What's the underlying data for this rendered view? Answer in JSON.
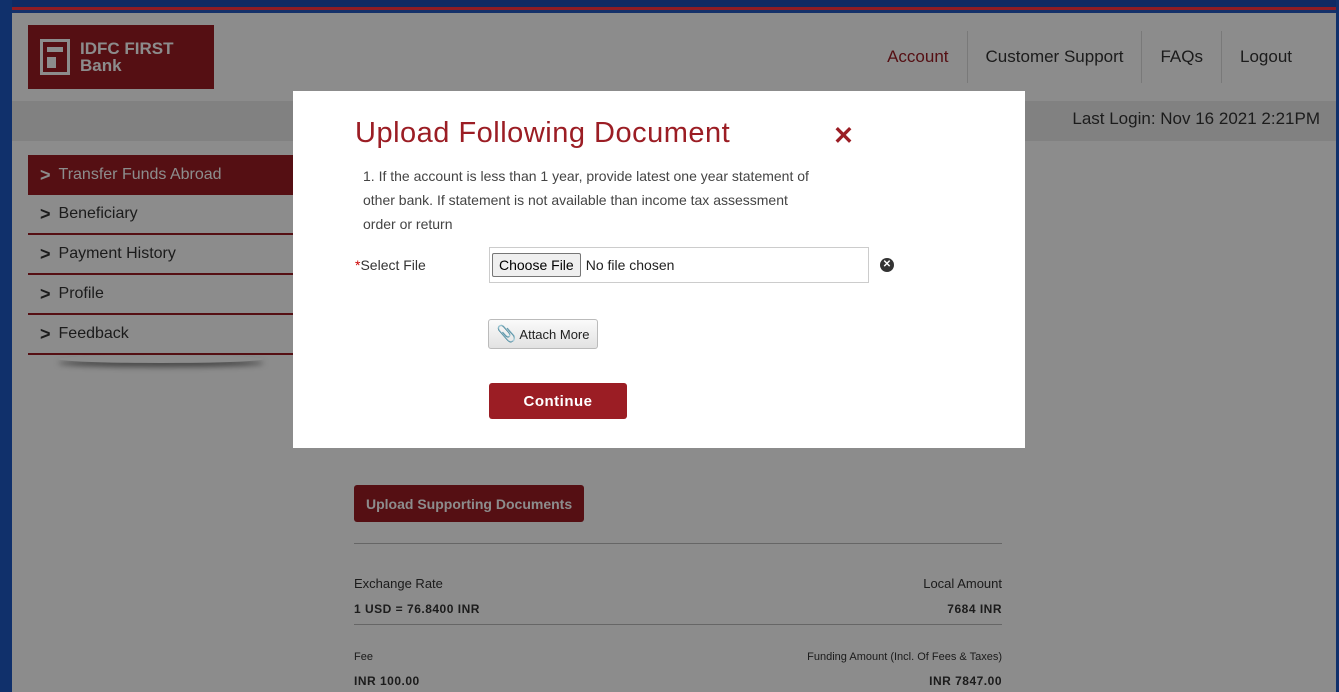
{
  "brand": {
    "name_line1": "IDFC FIRST",
    "name_line2": "Bank",
    "accent_color": "#9b1d24"
  },
  "nav": {
    "items": [
      {
        "label": "Account"
      },
      {
        "label": "Customer Support"
      },
      {
        "label": "FAQs"
      },
      {
        "label": "Logout"
      }
    ]
  },
  "session": {
    "last_login": "Last Login: Nov 16 2021 2:21PM"
  },
  "sidebar": {
    "items": [
      {
        "label": "Transfer Funds Abroad",
        "active": true
      },
      {
        "label": "Beneficiary"
      },
      {
        "label": "Payment History"
      },
      {
        "label": "Profile"
      },
      {
        "label": "Feedback"
      }
    ]
  },
  "content": {
    "upload_button": "Upload Supporting Documents",
    "exchange_rate_label": "Exchange Rate",
    "exchange_rate_value": "1 USD = 76.8400 INR",
    "local_amount_label": "Local Amount",
    "local_amount_value": "7684  INR",
    "fee_label": "Fee",
    "fee_value": "INR 100.00",
    "funding_amount_label": "Funding Amount (Incl. Of Fees & Taxes)",
    "funding_amount_value": "INR 7847.00"
  },
  "modal": {
    "title": "Upload Following Document",
    "close_glyph": "✕",
    "instructions": "1. If the account is less than 1 year, provide latest one year statement of other bank. If statement is not available than income tax assessment order or return",
    "select_required_mark": "*",
    "select_label": "Select File",
    "choose_file_label": "Choose File",
    "file_status": "No file chosen",
    "attach_more_label": "Attach More",
    "continue_label": "Continue"
  }
}
